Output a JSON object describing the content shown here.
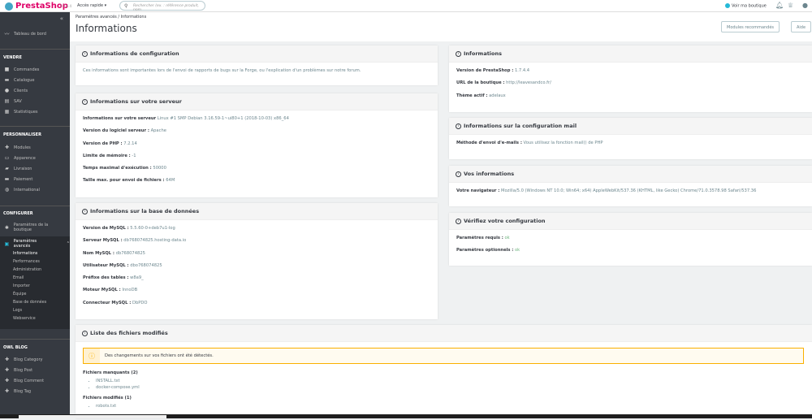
{
  "top": {
    "brand": "PrestaShop",
    "version": "1.7.4.4",
    "quick_access": "Accès rapide ▾",
    "search_placeholder": "Rechercher (ex. : référence produit, nom",
    "view_shop": "Voir ma boutique"
  },
  "sidebar": {
    "dashboard": "Tableau de bord",
    "sections": [
      {
        "title": "VENDRE",
        "items": [
          "Commandes",
          "Catalogue",
          "Clients",
          "SAV",
          "Statistiques"
        ]
      },
      {
        "title": "PERSONNALISER",
        "items": [
          "Modules",
          "Apparence",
          "Livraison",
          "Paiement",
          "International"
        ]
      },
      {
        "title": "CONFIGURER",
        "items": [
          "Paramètres de la boutique",
          "Paramètres avancés"
        ]
      },
      {
        "title": "OWL BLOG",
        "items": [
          "Blog Category",
          "Blog Post",
          "Blog Comment",
          "Blog Tag"
        ]
      }
    ],
    "sub_items": [
      "Informations",
      "Performances",
      "Administration",
      "Email",
      "Importer",
      "Équipe",
      "Base de données",
      "Logs",
      "Webservice"
    ]
  },
  "header": {
    "breadcrumb": "Paramètres avancés  /  Informations",
    "title": "Informations",
    "btn_modules": "Modules recommandés",
    "btn_help": "Aide"
  },
  "config": {
    "title": "Informations de configuration",
    "text": "Ces informations sont importantes lors de l'envoi de rapports de bugs sur la Forge, ou l'explication d'un problèmes sur notre forum."
  },
  "server": {
    "title": "Informations sur votre serveur",
    "rows": [
      {
        "k": "Informations sur votre serveur",
        "v": " Linux #1 SMP Debian 3.16.59-1~ui80+1 (2018-10-03) x86_64"
      },
      {
        "k": "Version du logiciel serveur :",
        "v": " Apache"
      },
      {
        "k": "Version de PHP :",
        "v": " 7.2.14"
      },
      {
        "k": "Limite de mémoire :",
        "v": " -1"
      },
      {
        "k": "Temps maximal d'exécution :",
        "v": " 50000"
      },
      {
        "k": "Taille max. pour envoi de fichiers :",
        "v": " 64M"
      }
    ]
  },
  "db": {
    "title": "Informations sur la base de données",
    "rows": [
      {
        "k": "Version de MySQL :",
        "v": " 5.5.60-0+deb7u1-log"
      },
      {
        "k": "Serveur MySQL :",
        "v": " db768074825.hosting-data.io"
      },
      {
        "k": "Nom MySQL :",
        "v": " db768074825"
      },
      {
        "k": "Utilisateur MySQL :",
        "v": " dbo768074825"
      },
      {
        "k": "Préfixe des tables :",
        "v": " w8a9_"
      },
      {
        "k": "Moteur MySQL :",
        "v": " InnoDB"
      },
      {
        "k": "Connecteur MySQL :",
        "v": " DbPDO"
      }
    ]
  },
  "files": {
    "title": "Liste des fichiers modifiés",
    "alert": "Des changements sur vos fichiers ont été détectés.",
    "missing_title": "Fichiers manquants (2)",
    "missing": [
      "INSTALL.txt",
      "docker-compose.yml"
    ],
    "modified_title": "Fichiers modifiés (1)",
    "modified": [
      "robots.txt"
    ]
  },
  "info": {
    "title": "Informations",
    "rows": [
      {
        "k": "Version de PrestaShop :",
        "v": " 1.7.4.4"
      },
      {
        "k": "URL de la boutique :",
        "v": " http://leavesandco.fr/"
      },
      {
        "k": "Thème actif :",
        "v": " adelaux"
      }
    ]
  },
  "mail": {
    "title": "Informations sur la configuration mail",
    "rows": [
      {
        "k": "Méthode d'envoi d'e-mails :",
        "v": " Vous utilisez la fonction mail() de PHP"
      }
    ]
  },
  "you": {
    "title": "Vos informations",
    "rows": [
      {
        "k": "Votre navigateur :",
        "v": " Mozilla/5.0 (Windows NT 10.0; Win64; x64) AppleWebKit/537.36 (KHTML, like Gecko) Chrome/71.0.3578.98 Safari/537.36"
      }
    ]
  },
  "check": {
    "title": "Vérifiez votre configuration",
    "rows": [
      {
        "k": "Paramètres requis :",
        "v": " ok"
      },
      {
        "k": "Paramètres optionnels :",
        "v": " ok"
      }
    ]
  },
  "colors": {
    "brand": "#df0067",
    "sidebar": "#363a41",
    "accent": "#25b9d7",
    "warning": "#fab000"
  }
}
